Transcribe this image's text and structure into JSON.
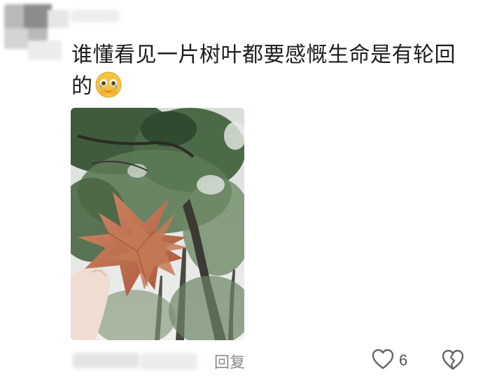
{
  "comment": {
    "text": "谁懂看见一片树叶都要感慨生命是有轮回的",
    "emoji": "face-holding-back-tears-emoji"
  },
  "photo": {
    "subject": "maple-leaves-against-trees"
  },
  "actions": {
    "reply_label": "回复",
    "like_count": "6",
    "like_icon": "heart-outline-icon",
    "dislike_icon": "broken-heart-icon"
  },
  "colors": {
    "text": "#1c1c1c",
    "muted": "#8a8a8a",
    "icon": "#666666"
  }
}
